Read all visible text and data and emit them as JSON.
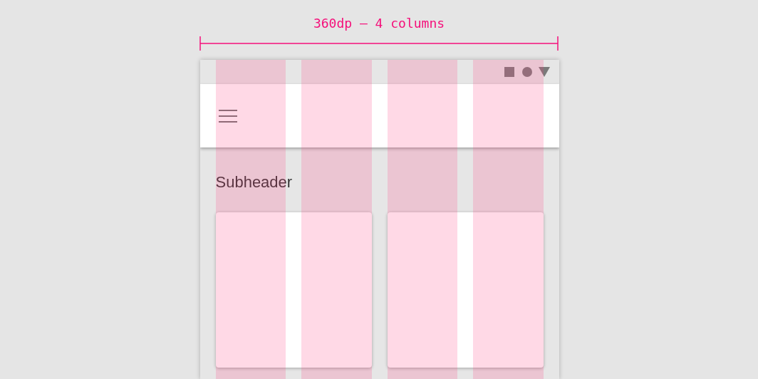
{
  "measure": {
    "label": "360dp – 4 columns"
  },
  "content": {
    "subheader": "Subheader"
  }
}
